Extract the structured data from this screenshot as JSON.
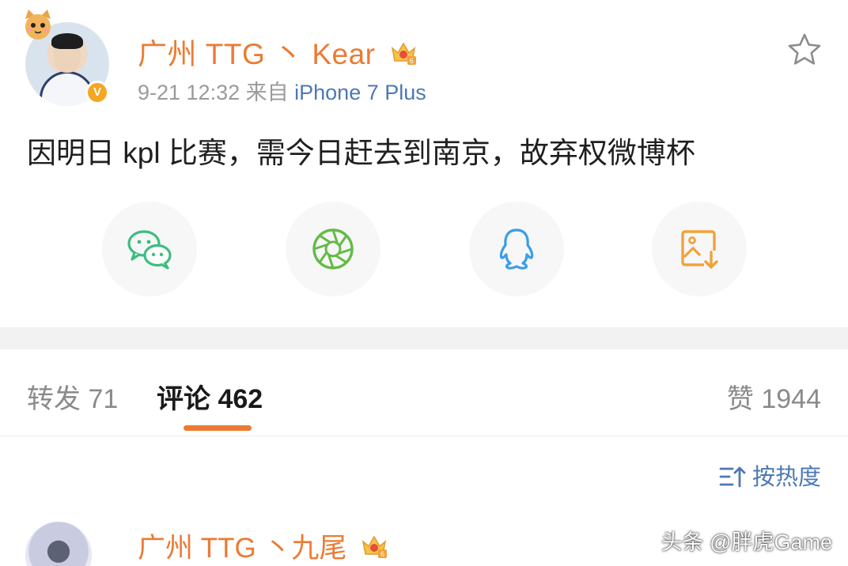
{
  "post": {
    "username": "广州 TTG 丶 Kear",
    "time": "9-21 12:32",
    "source_prefix": "来自",
    "device": "iPhone 7 Plus",
    "verified_badge": "V",
    "text": "因明日 kpl 比赛，需今日赶去到南京，故弃权微博杯",
    "icons": {
      "favorite": "star-icon",
      "member": "crown-icon"
    }
  },
  "share": [
    {
      "name": "wechat-icon",
      "color": "#3dbd82"
    },
    {
      "name": "moments-icon",
      "color": "#62bb46"
    },
    {
      "name": "qq-icon",
      "color": "#3a9ee8"
    },
    {
      "name": "save-image-icon",
      "color": "#f0a23a"
    }
  ],
  "tabs": {
    "repost": "转发 71",
    "comments": "评论 462",
    "likes": "赞 1944"
  },
  "sort": {
    "label": "按热度"
  },
  "comment": {
    "username": "广州 TTG 丶九尾"
  },
  "watermark": "头条 @胖虎Game",
  "colors": {
    "accent": "#eb7b34",
    "link": "#4d78b5",
    "muted": "#9a9a9a"
  }
}
